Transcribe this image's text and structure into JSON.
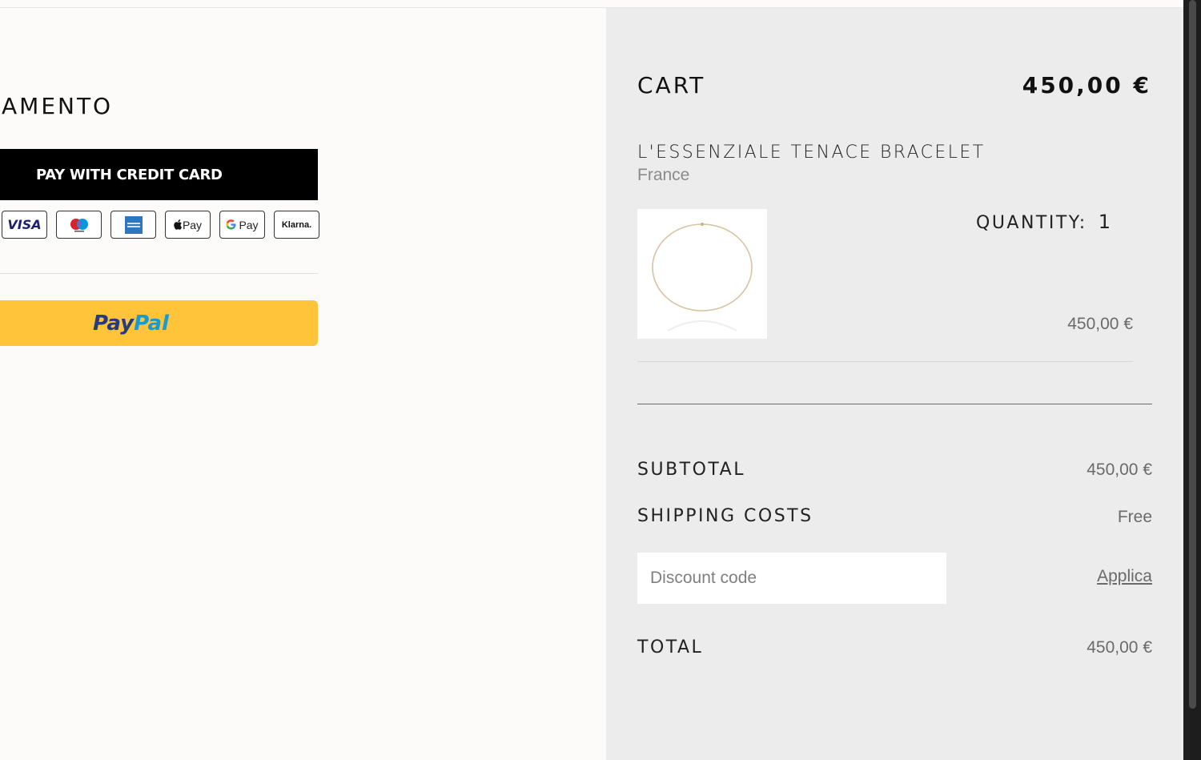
{
  "payment": {
    "section_title": "AMENTO",
    "credit_card_button": "PAY WITH CREDIT CARD",
    "logos": {
      "visa": "VISA",
      "apple_pay": "Pay",
      "google_pay": "Pay",
      "klarna": "Klarna."
    },
    "paypal_part1": "Pay",
    "paypal_part2": "Pal"
  },
  "cart": {
    "title": "CART",
    "header_total": "450,00 €",
    "item": {
      "name": "L'ESSENZIALE TENACE BRACELET",
      "country": "France",
      "quantity_label": "QUANTITY:",
      "quantity": "1",
      "price": "450,00 €"
    },
    "summary": {
      "subtotal_label": "SUBTOTAL",
      "subtotal_value": "450,00 €",
      "shipping_label": "SHIPPING COSTS",
      "shipping_value": "Free",
      "discount_placeholder": "Discount code",
      "apply_label": "Applica",
      "total_label": "TOTAL",
      "total_value": "450,00 €"
    }
  },
  "colors": {
    "paypal_yellow": "#ffc439",
    "paypal_dark_blue": "#253b80",
    "paypal_light_blue": "#179bd7",
    "panel_gray": "#ececec"
  }
}
